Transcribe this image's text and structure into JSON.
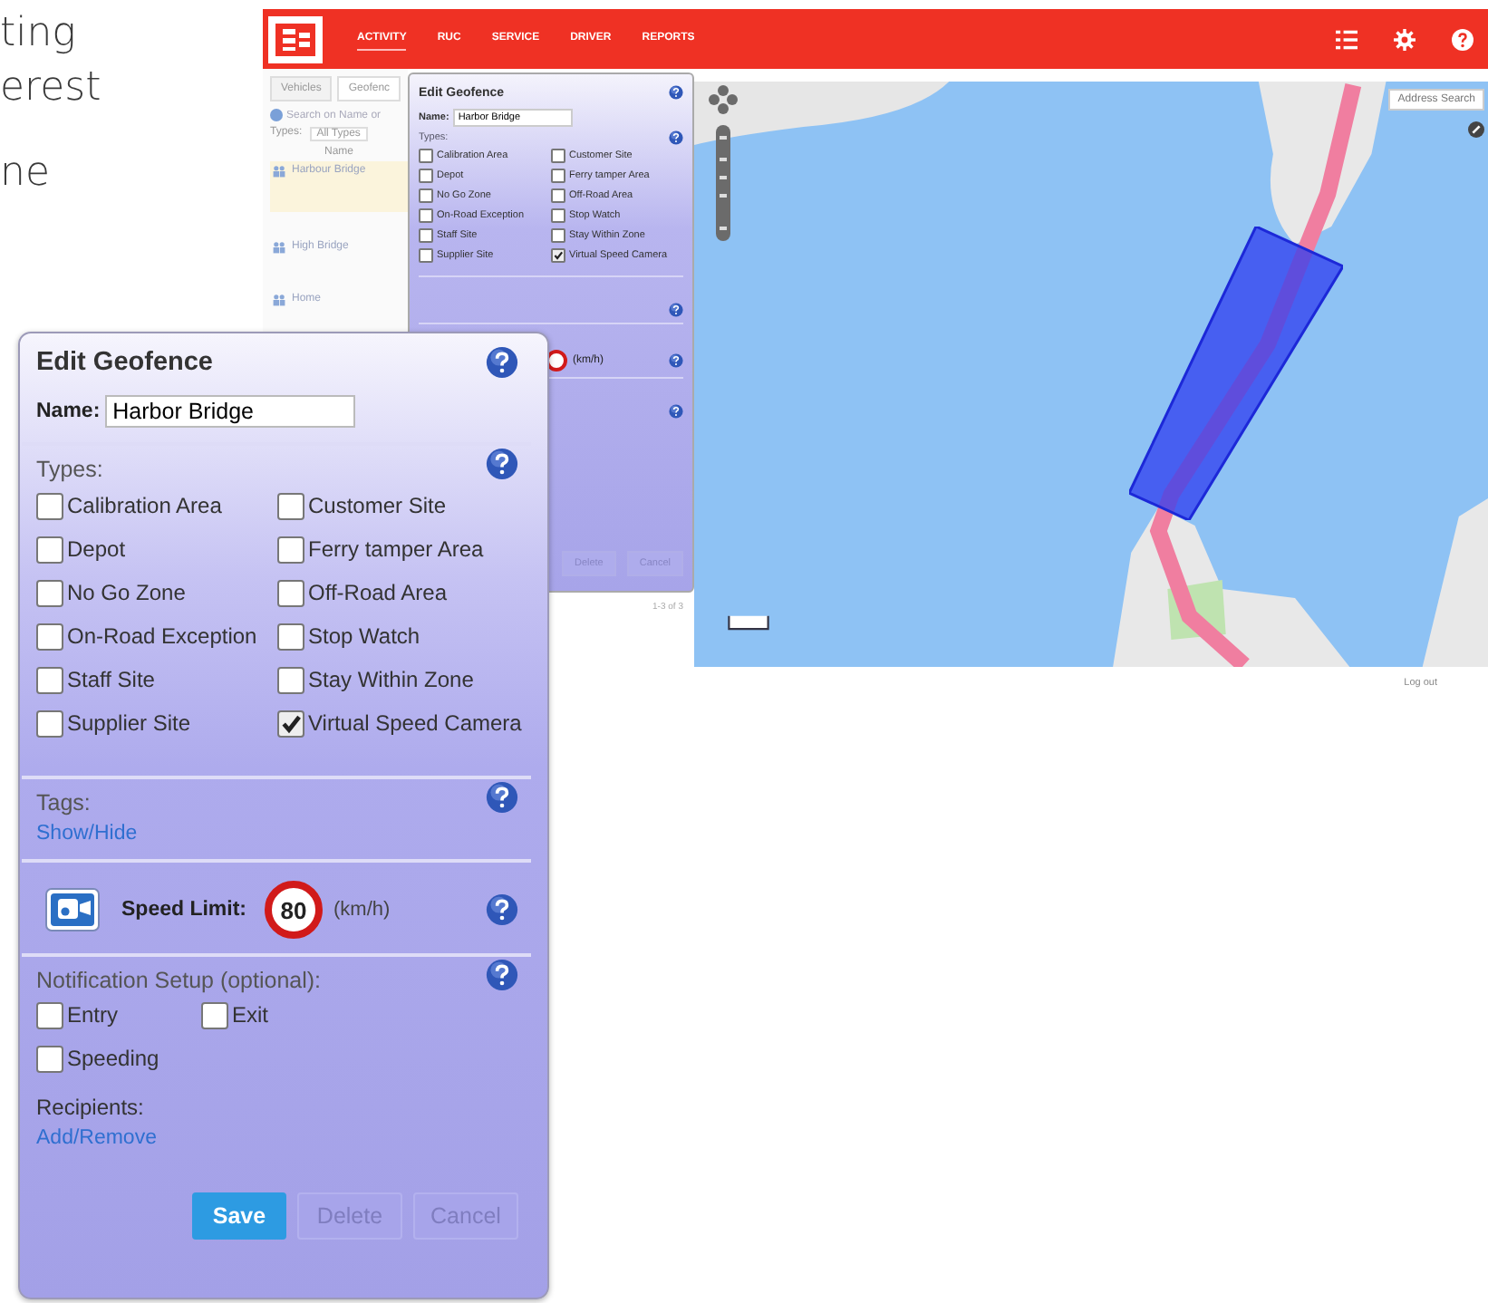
{
  "intro": {
    "paragraphs": [
      [
        "ting",
        "erest"
      ],
      [
        "ne"
      ]
    ]
  },
  "app": {
    "nav": [
      {
        "label": "ACTIVITY",
        "selected": true
      },
      {
        "label": "RUC",
        "selected": false
      },
      {
        "label": "SERVICE",
        "selected": false
      },
      {
        "label": "DRIVER",
        "selected": false
      },
      {
        "label": "REPORTS",
        "selected": false
      }
    ],
    "side_tabs": [
      {
        "label": "Vehicles",
        "selected": false
      },
      {
        "label": "Geofenc",
        "selected": true
      }
    ],
    "search": {
      "placeholder": "Search on Name or"
    },
    "type_filter": {
      "label": "Types:",
      "value": "All Types"
    },
    "list_header": "Name",
    "geofences": [
      {
        "name": "Harbour Bridge",
        "selected": true
      },
      {
        "name": "High Bridge",
        "selected": false
      },
      {
        "name": "Home",
        "selected": false
      }
    ],
    "pager": "1-3 of 3",
    "logout": "Log out",
    "map": {
      "search_button": "Address Search"
    }
  },
  "background_editor": {
    "title": "Edit Geofence",
    "name_label": "Name:",
    "name_value": "Harbor Bridge",
    "types_label": "Types:",
    "types": [
      {
        "label": "Calibration Area",
        "checked": false
      },
      {
        "label": "Customer Site",
        "checked": false
      },
      {
        "label": "Depot",
        "checked": false
      },
      {
        "label": "Ferry tamper Area",
        "checked": false
      },
      {
        "label": "No Go Zone",
        "checked": false
      },
      {
        "label": "Off-Road Area",
        "checked": false
      },
      {
        "label": "On-Road Exception",
        "checked": false
      },
      {
        "label": "Stop Watch",
        "checked": false
      },
      {
        "label": "Staff Site",
        "checked": false
      },
      {
        "label": "Stay Within Zone",
        "checked": false
      },
      {
        "label": "Supplier Site",
        "checked": false
      },
      {
        "label": "Virtual Speed Camera",
        "checked": true
      }
    ],
    "speed_unit": "(km/h)",
    "buttons": [
      {
        "label": "Delete",
        "disabled": true
      },
      {
        "label": "Cancel",
        "disabled": true
      }
    ]
  },
  "editor": {
    "title": "Edit Geofence",
    "name_label": "Name:",
    "name_value": "Harbor Bridge",
    "types_label": "Types:",
    "types": [
      {
        "label": "Calibration Area",
        "checked": false
      },
      {
        "label": "Customer Site",
        "checked": false
      },
      {
        "label": "Depot",
        "checked": false
      },
      {
        "label": "Ferry tamper Area",
        "checked": false
      },
      {
        "label": "No Go Zone",
        "checked": false
      },
      {
        "label": "Off-Road Area",
        "checked": false
      },
      {
        "label": "On-Road Exception",
        "checked": false
      },
      {
        "label": "Stop Watch",
        "checked": false
      },
      {
        "label": "Staff Site",
        "checked": false
      },
      {
        "label": "Stay Within Zone",
        "checked": false
      },
      {
        "label": "Supplier Site",
        "checked": false
      },
      {
        "label": "Virtual Speed Camera",
        "checked": true
      }
    ],
    "tags_label": "Tags:",
    "tags_link": "Show/Hide",
    "speed_label": "Speed Limit:",
    "speed_value": "80",
    "speed_unit": "(km/h)",
    "notification_label": "Notification Setup (optional):",
    "notifications": [
      {
        "label": "Entry",
        "checked": false
      },
      {
        "label": "Exit",
        "checked": false
      },
      {
        "label": "Speeding",
        "checked": false
      }
    ],
    "recipients_label": "Recipients:",
    "recipients_link": "Add/Remove",
    "buttons": [
      {
        "label": "Save",
        "disabled": false
      },
      {
        "label": "Delete",
        "disabled": true
      },
      {
        "label": "Cancel",
        "disabled": true
      }
    ]
  }
}
